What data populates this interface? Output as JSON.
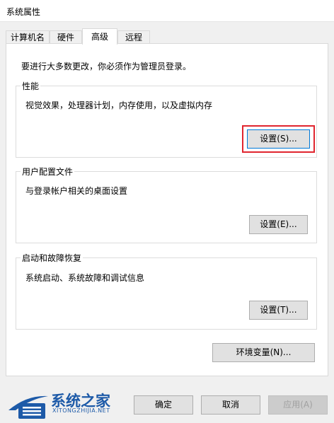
{
  "window": {
    "title": "系统属性"
  },
  "tabs": [
    {
      "label": "计算机名",
      "active": false
    },
    {
      "label": "硬件",
      "active": false
    },
    {
      "label": "高级",
      "active": true
    },
    {
      "label": "远程",
      "active": false
    }
  ],
  "intro_text": "要进行大多数更改，你必须作为管理员登录。",
  "groups": {
    "performance": {
      "title": "性能",
      "desc": "视觉效果，处理器计划，内存使用，以及虚拟内存",
      "button": "设置(S)..."
    },
    "user_profiles": {
      "title": "用户配置文件",
      "desc": "与登录帐户相关的桌面设置",
      "button": "设置(E)..."
    },
    "startup_recovery": {
      "title": "启动和故障恢复",
      "desc": "系统启动、系统故障和调试信息",
      "button": "设置(T)..."
    }
  },
  "env_button": "环境变量(N)...",
  "footer": {
    "ok": "确定",
    "cancel": "取消",
    "apply": "应用(A)"
  },
  "watermark": {
    "name": "系统之家",
    "url": "XITONGZHIJIA.NET",
    "color": "#1d5aa8"
  },
  "highlight_color": "#e0252f"
}
